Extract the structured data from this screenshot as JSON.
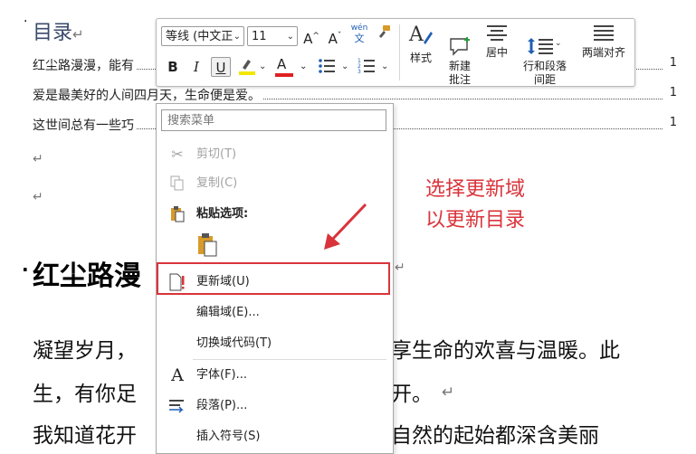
{
  "document": {
    "toc_title": "目录",
    "toc_entries": [
      {
        "text": "红尘路漫漫，能有",
        "page": "1"
      },
      {
        "text": "爱是最美好的人间四月天，生命便是爱。",
        "page": "1"
      },
      {
        "text": "这世间总有一些巧",
        "page": "1"
      }
    ],
    "heading": "红尘路漫",
    "body_lines": [
      {
        "left": "凝望岁月，",
        "right": "享生命的欢喜与温暖。此"
      },
      {
        "left": "生，有你足",
        "right": "开。"
      },
      {
        "left": "我知道花开",
        "right": "自然的起始都深含美丽"
      }
    ],
    "para_mark": "↵"
  },
  "toolbar": {
    "font_name": "等线 (中文正",
    "font_size": "11",
    "grow_font": "A",
    "shrink_font": "A",
    "phonetic_top": "wén",
    "phonetic_bottom": "文",
    "bold": "B",
    "italic": "I",
    "underline": "U",
    "font_color_letter": "A",
    "styles_label": "样式",
    "new_comment_label": "新建\n批注",
    "center_label": "居中",
    "line_spacing_label": "行和段落\n间距",
    "justify_label": "两端对齐",
    "colors": {
      "highlight": "#f3e600",
      "font_color": "#e02020"
    }
  },
  "context_menu": {
    "search_placeholder": "搜索菜单",
    "items": [
      {
        "icon": "scissors-icon",
        "label": "剪切(T)",
        "disabled": true
      },
      {
        "icon": "copy-icon",
        "label": "复制(C)",
        "disabled": true
      },
      {
        "icon": "clipboard-icon",
        "label": "粘贴选项:",
        "disabled": false
      },
      {
        "icon": "update-field-icon",
        "label": "更新域(U)",
        "disabled": false
      },
      {
        "icon": "",
        "label": "编辑域(E)...",
        "disabled": false
      },
      {
        "icon": "",
        "label": "切换域代码(T)",
        "disabled": false
      },
      {
        "icon": "font-icon",
        "label": "字体(F)...",
        "disabled": false
      },
      {
        "icon": "paragraph-icon",
        "label": "段落(P)...",
        "disabled": false
      },
      {
        "icon": "",
        "label": "插入符号(S)",
        "disabled": false
      }
    ]
  },
  "annotation": {
    "line1": "选择更新域",
    "line2": "以更新目录",
    "color": "#d9343b"
  }
}
